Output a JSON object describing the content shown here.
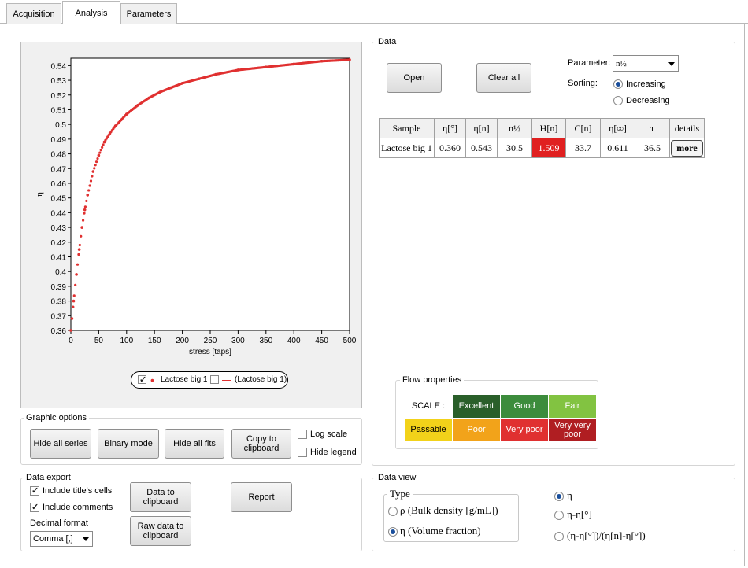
{
  "tabs": [
    "Acquisition",
    "Analysis",
    "Parameters"
  ],
  "chart_data": {
    "type": "scatter",
    "xlabel": "stress [taps]",
    "ylabel": "η",
    "xlim": [
      0,
      500
    ],
    "ylim": [
      0.36,
      0.545
    ],
    "xticks": [
      "0",
      "50",
      "100",
      "150",
      "200",
      "250",
      "300",
      "350",
      "400",
      "450",
      "500"
    ],
    "yticks": [
      "0.36",
      "0.37",
      "0.38",
      "0.39",
      "0.4",
      "0.41",
      "0.42",
      "0.43",
      "0.44",
      "0.45",
      "0.46",
      "0.47",
      "0.48",
      "0.49",
      "0.5",
      "0.51",
      "0.52",
      "0.53",
      "0.54"
    ],
    "grid": false,
    "color": "#e03030",
    "series": [
      {
        "name": "Lactose big 1",
        "x": [
          0,
          2,
          5,
          10,
          15,
          20,
          25,
          30,
          40,
          50,
          60,
          70,
          80,
          90,
          100,
          120,
          140,
          160,
          180,
          200,
          230,
          260,
          300,
          350,
          400,
          450,
          500
        ],
        "y": [
          0.36,
          0.368,
          0.38,
          0.398,
          0.415,
          0.43,
          0.442,
          0.452,
          0.468,
          0.479,
          0.488,
          0.494,
          0.499,
          0.503,
          0.507,
          0.513,
          0.518,
          0.522,
          0.525,
          0.528,
          0.531,
          0.534,
          0.537,
          0.539,
          0.541,
          0.543,
          0.544
        ]
      }
    ],
    "legend": [
      {
        "checked": true,
        "label": "Lactose big 1"
      },
      {
        "checked": false,
        "label": "(Lactose big 1)"
      }
    ]
  },
  "graphic_options": {
    "title": "Graphic options",
    "hide_all_series": "Hide all series",
    "binary_mode": "Binary mode",
    "hide_all_fits": "Hide all fits",
    "copy_clipboard": "Copy to clipboard",
    "log_scale": "Log scale",
    "hide_legend": "Hide legend"
  },
  "data_export": {
    "title": "Data export",
    "include_titles": "Include title's cells",
    "include_comments": "Include comments",
    "decimal_format_label": "Decimal format",
    "decimal_format_value": "Comma [,]",
    "data_to_clipboard": "Data to clipboard",
    "raw_data_to_clipboard": "Raw data to clipboard",
    "report": "Report"
  },
  "data": {
    "title": "Data",
    "open": "Open",
    "clear_all": "Clear all",
    "parameter_label": "Parameter:",
    "parameter_value": "n½",
    "sorting_label": "Sorting:",
    "increasing": "Increasing",
    "decreasing": "Decreasing",
    "headers": [
      "Sample",
      "η[°]",
      "η[n]",
      "n½",
      "H[n]",
      "C[n]",
      "η[∞]",
      "τ",
      "details"
    ],
    "row": [
      "Lactose big 1",
      "0.360",
      "0.543",
      "30.5",
      "1.509",
      "33.7",
      "0.611",
      "36.5",
      "more"
    ],
    "highlight_color": "#e02020"
  },
  "flow": {
    "title": "Flow properties",
    "scale_label": "SCALE :",
    "excellent": "Excellent",
    "good": "Good",
    "fair": "Fair",
    "passable": "Passable",
    "poor": "Poor",
    "very_poor": "Very poor",
    "very_very_poor": "Very very poor"
  },
  "data_view": {
    "title": "Data view",
    "type_label": "Type",
    "rho": "ρ (Bulk density [g/mL])",
    "eta_vf": "η (Volume fraction)",
    "eta": "η",
    "eta_diff": "η-η[°]",
    "eta_norm": "(η-η[°])/(η[n]-η[°])"
  }
}
